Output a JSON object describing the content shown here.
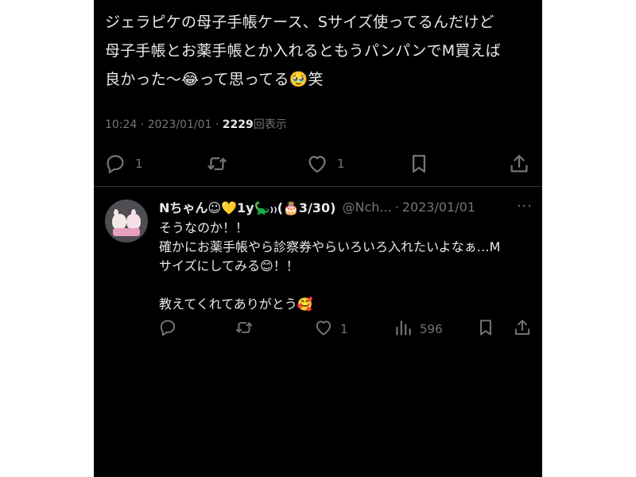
{
  "tweet": {
    "lines": [
      "ジェラピケの母子手帳ケース、Sサイズ使ってるんだけど",
      "母子手帳とお薬手帳とか入れるともうパンパンでM買えば",
      "良かった〜😂って思ってる🥹笑"
    ],
    "time": "10:24",
    "date": "2023/01/01",
    "views_count": "2229",
    "views_label": "回表示",
    "sep": "·",
    "actions": {
      "reply_count": "1",
      "retweet_count": "",
      "like_count": "1"
    }
  },
  "reply": {
    "display_name": "Nちゃん☺︎💛1y🦕₎₎(🎂3/30)",
    "handle": "@Nch...",
    "sep": "·",
    "date": "2023/01/01",
    "more": "···",
    "lines": [
      "そうなのか！！",
      "確かにお薬手帳やら診察券やらいろいろ入れたいよなぁ…M",
      "サイズにしてみる😊！！",
      "",
      "教えてくれてありがとう🥰"
    ],
    "actions": {
      "reply_count": "",
      "retweet_count": "",
      "like_count": "1",
      "views_count": "596"
    }
  },
  "colors": {
    "background": "#000000",
    "text": "#e7e9ea",
    "muted": "#71767b",
    "divider": "#2f3336"
  },
  "icons": {
    "reply": "speech-bubble-icon",
    "retweet": "retweet-arrows-icon",
    "like": "heart-icon",
    "bookmark": "bookmark-icon",
    "share": "share-upload-icon",
    "views": "bar-chart-icon",
    "more": "more-horizontal-icon"
  }
}
